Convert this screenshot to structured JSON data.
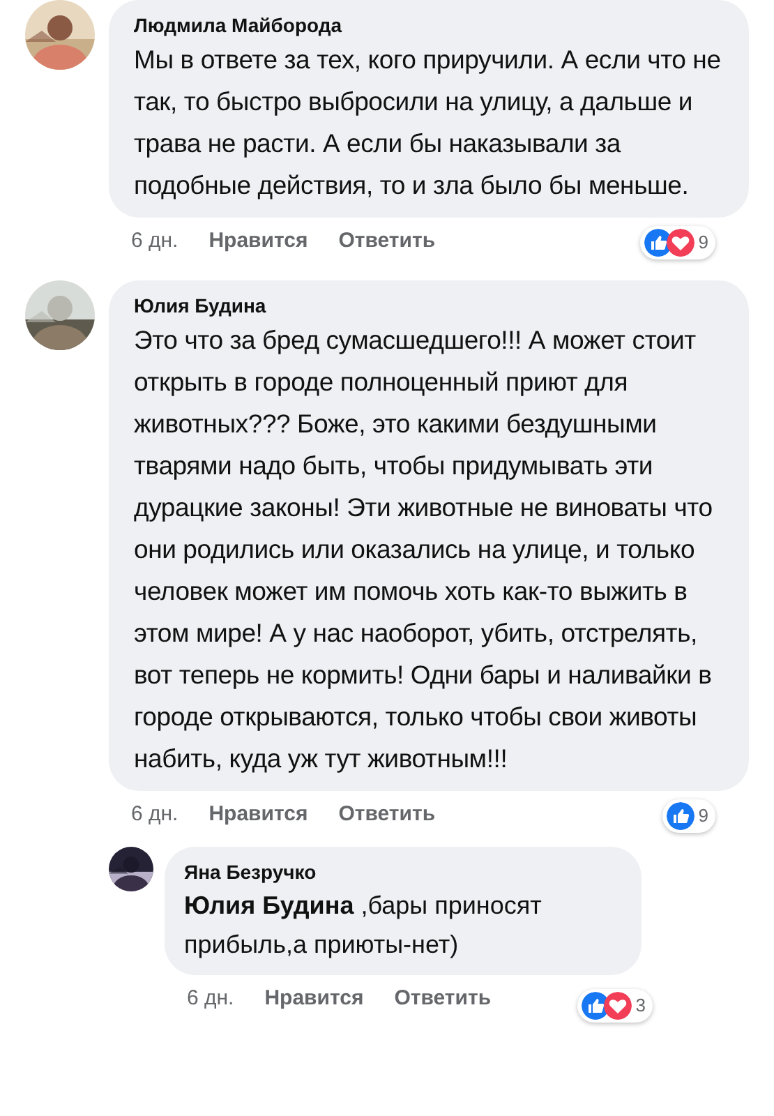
{
  "comments": [
    {
      "author": "Людмила Майборода",
      "text": "Мы в ответе за тех, кого приручили. А если что не так, то быстро выбросили на улицу, а дальше и трава не расти. А если бы наказывали за подобные действия, то и зла было бы меньше.",
      "time": "6 дн.",
      "like": "Нравится",
      "reply": "Ответить",
      "reactions": [
        {
          "kind": "like"
        },
        {
          "kind": "love"
        }
      ],
      "reaction_count": "9"
    },
    {
      "author": "Юлия Будина",
      "text": "Это что за бред сумасшедшего!!! А может стоит открыть в городе полноценный приют для животных??? Боже, это какими бездушными тварями надо быть, чтобы придумывать эти дурацкие законы! Эти животные не виноваты что они родились или оказались на улице, и только человек может им помочь хоть как-то выжить в этом мире! А у нас наоборот, убить, отстрелять, вот теперь не кормить! Одни бары и наливайки в городе открываются, только чтобы свои животы набить, куда уж тут животным!!!",
      "time": "6 дн.",
      "like": "Нравится",
      "reply": "Ответить",
      "reactions": [
        {
          "kind": "like"
        }
      ],
      "reaction_count": "9",
      "replies": [
        {
          "author": "Яна Безручко",
          "text": "**Юлия Будина** ,бары приносят прибыль,а приюты-нет)",
          "time": "6 дн.",
          "like": "Нравится",
          "reply": "Ответить",
          "reactions": [
            {
              "kind": "like"
            },
            {
              "kind": "love"
            }
          ],
          "reaction_count": "3"
        }
      ]
    }
  ]
}
